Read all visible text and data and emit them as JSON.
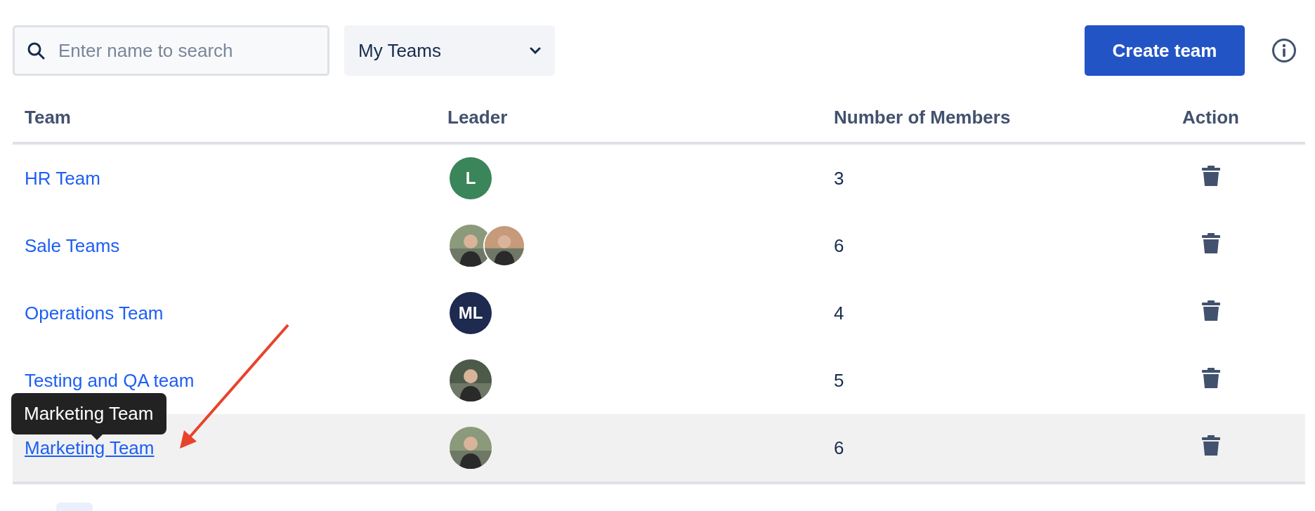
{
  "toolbar": {
    "search": {
      "placeholder": "Enter name to search"
    },
    "filter": {
      "value": "My Teams"
    },
    "create_button": "Create team"
  },
  "table": {
    "columns": [
      "Team",
      "Leader",
      "Number of Members",
      "Action"
    ],
    "rows": [
      {
        "team": "HR Team",
        "leaders": [
          {
            "kind": "initials",
            "initials": "L",
            "color": "#3a8559"
          }
        ],
        "members": "3",
        "hovered": false
      },
      {
        "team": "Sale Teams",
        "members": "6",
        "hovered": false
      },
      {
        "team": "Operations Team",
        "leaders": [
          {
            "kind": "initials",
            "initials": "ML",
            "color": "#1e2a4f"
          }
        ],
        "members": "4",
        "hovered": false
      },
      {
        "team": "Testing and QA team",
        "members": "5",
        "hovered": false
      },
      {
        "team": "Marketing Team",
        "members": "6",
        "hovered": true
      }
    ]
  },
  "tooltip": {
    "text": "Marketing Team"
  }
}
